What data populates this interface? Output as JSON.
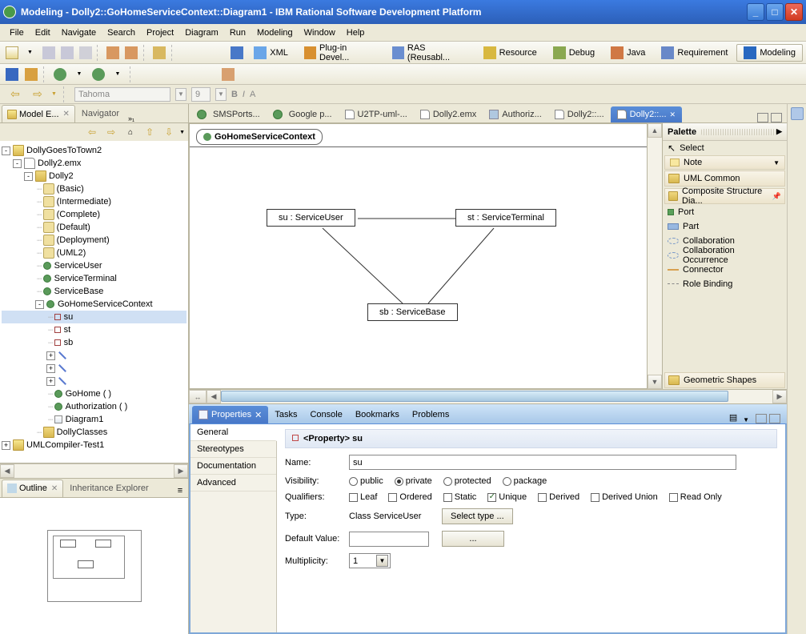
{
  "window": {
    "title": "Modeling - Dolly2::GoHomeServiceContext::Diagram1 - IBM Rational Software Development Platform"
  },
  "menubar": {
    "items": [
      "File",
      "Edit",
      "Navigate",
      "Search",
      "Project",
      "Diagram",
      "Run",
      "Modeling",
      "Window",
      "Help"
    ]
  },
  "perspectives": [
    "XML",
    "Plug-in Devel...",
    "RAS (Reusabl...",
    "Resource",
    "Debug",
    "Java",
    "Requirement",
    "Modeling"
  ],
  "fontbar": {
    "font": "Tahoma",
    "size": "9"
  },
  "modelExplorer": {
    "tabs": [
      "Model E...",
      "Navigator"
    ],
    "tree": {
      "root": "DollyGoesToTown2",
      "file": "Dolly2.emx",
      "pkg": "Dolly2",
      "viewpoints": [
        "(Basic)",
        "(Intermediate)",
        "(Complete)",
        "(Default)",
        "(Deployment)",
        "(UML2)"
      ],
      "classes": [
        "ServiceUser",
        "ServiceTerminal",
        "ServiceBase"
      ],
      "context": "GoHomeServiceContext",
      "parts": [
        "su",
        "st",
        "sb"
      ],
      "ops": [
        "GoHome ( )",
        "Authorization ( )"
      ],
      "diagram": "Diagram1",
      "extraPkg": "DollyClasses",
      "proj2": "UMLCompiler-Test1"
    }
  },
  "outline": {
    "tabs": [
      "Outline",
      "Inheritance Explorer"
    ]
  },
  "editor": {
    "tabs": [
      "SMSPorts...",
      "Google p...",
      "U2TP-uml-...",
      "Dolly2.emx",
      "Authoriz...",
      "Dolly2::...",
      "Dolly2::..."
    ],
    "activeDiagram": "GoHomeServiceContext",
    "parts": {
      "su": "su : ServiceUser",
      "st": "st : ServiceTerminal",
      "sb": "sb : ServiceBase"
    }
  },
  "palette": {
    "title": "Palette",
    "select": "Select",
    "note": "Note",
    "drawers": [
      "UML Common",
      "Composite Structure Dia..."
    ],
    "tools": [
      "Port",
      "Part",
      "Collaboration",
      "Collaboration Occurrence",
      "Connector",
      "Role Binding"
    ],
    "geometric": "Geometric Shapes"
  },
  "bottom": {
    "tabs": [
      "Properties",
      "Tasks",
      "Console",
      "Bookmarks",
      "Problems"
    ],
    "sideTabs": [
      "General",
      "Stereotypes",
      "Documentation",
      "Advanced"
    ],
    "header": "<Property> su",
    "name": {
      "label": "Name:",
      "value": "su"
    },
    "visibility": {
      "label": "Visibility:",
      "opts": [
        "public",
        "private",
        "protected",
        "package"
      ],
      "selected": "private"
    },
    "qualifiers": {
      "label": "Qualifiers:",
      "opts": [
        "Leaf",
        "Ordered",
        "Static",
        "Unique",
        "Derived",
        "Derived Union",
        "Read Only"
      ],
      "checked": [
        "Unique"
      ]
    },
    "type": {
      "label": "Type:",
      "value": "Class ServiceUser",
      "btn": "Select type ..."
    },
    "defaultValue": {
      "label": "Default Value:",
      "value": "",
      "btn": "..."
    },
    "multiplicity": {
      "label": "Multiplicity:",
      "value": "1"
    }
  }
}
